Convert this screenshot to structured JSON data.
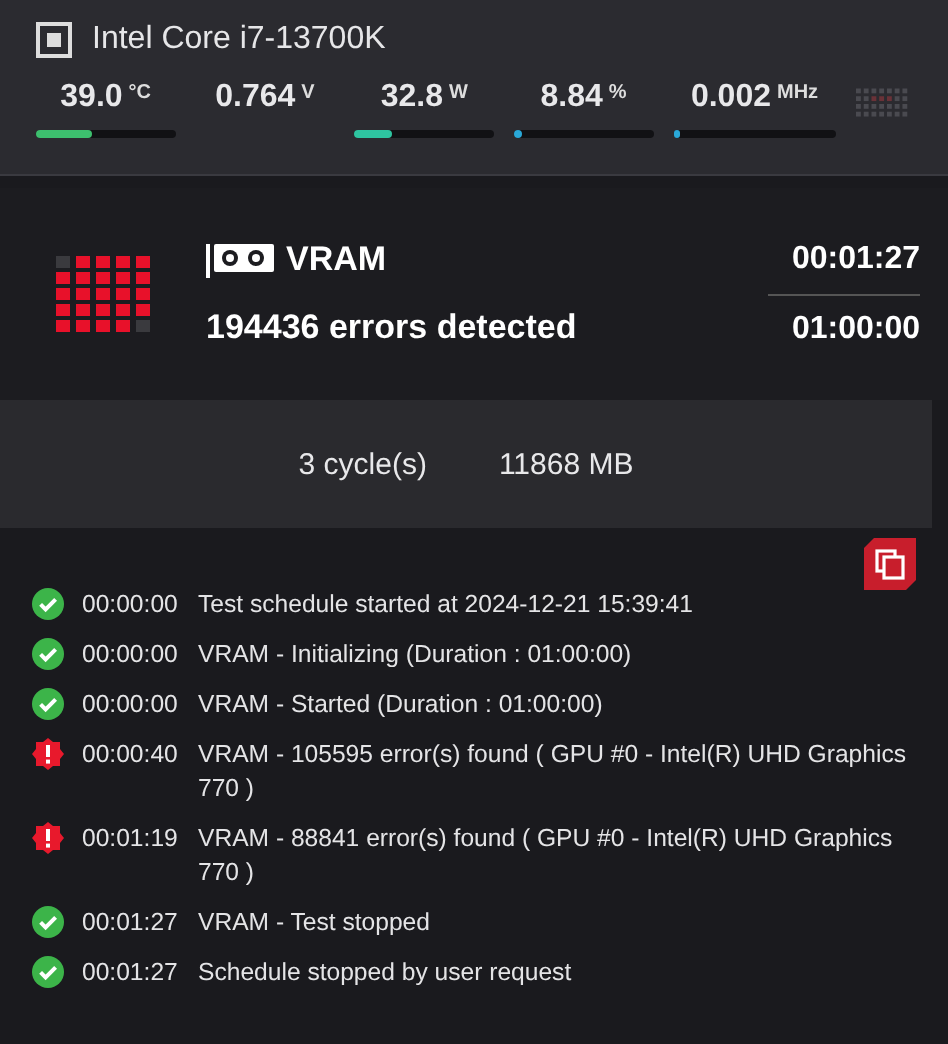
{
  "cpu": {
    "name": "Intel Core i7-13700K"
  },
  "metrics": [
    {
      "value": "39.0",
      "unit": "°C",
      "level": 0.4,
      "color": "#3dbf6e",
      "kind": "bar"
    },
    {
      "value": "0.764",
      "unit": "V",
      "kind": "plain"
    },
    {
      "value": "32.8",
      "unit": "W",
      "level": 0.27,
      "color": "#2ec4a0",
      "kind": "bar"
    },
    {
      "value": "8.84",
      "unit": "%",
      "level": 0.06,
      "color": "#2aa8d8",
      "kind": "bar"
    },
    {
      "value": "0.002",
      "unit": "MHz",
      "level": 0.01,
      "color": "#2aa8d8",
      "kind": "bar"
    }
  ],
  "test": {
    "name": "VRAM",
    "errors": "194436 errors detected",
    "elapsed": "00:01:27",
    "duration": "01:00:00",
    "cycles": "3 cycle(s)",
    "memory": "11868 MB"
  },
  "log": [
    {
      "kind": "ok",
      "time": "00:00:00",
      "message": "Test schedule started at 2024-12-21 15:39:41"
    },
    {
      "kind": "ok",
      "time": "00:00:00",
      "message": "VRAM - Initializing (Duration : 01:00:00)"
    },
    {
      "kind": "ok",
      "time": "00:00:00",
      "message": "VRAM - Started (Duration : 01:00:00)"
    },
    {
      "kind": "error",
      "time": "00:00:40",
      "message": "VRAM - 105595 error(s) found ( GPU #0 - Intel(R) UHD Graphics 770 )"
    },
    {
      "kind": "error",
      "time": "00:01:19",
      "message": "VRAM - 88841 error(s) found ( GPU #0 - Intel(R) UHD Graphics 770 )"
    },
    {
      "kind": "ok",
      "time": "00:01:27",
      "message": "VRAM - Test stopped"
    },
    {
      "kind": "ok",
      "time": "00:01:27",
      "message": "Schedule stopped by user request"
    }
  ]
}
